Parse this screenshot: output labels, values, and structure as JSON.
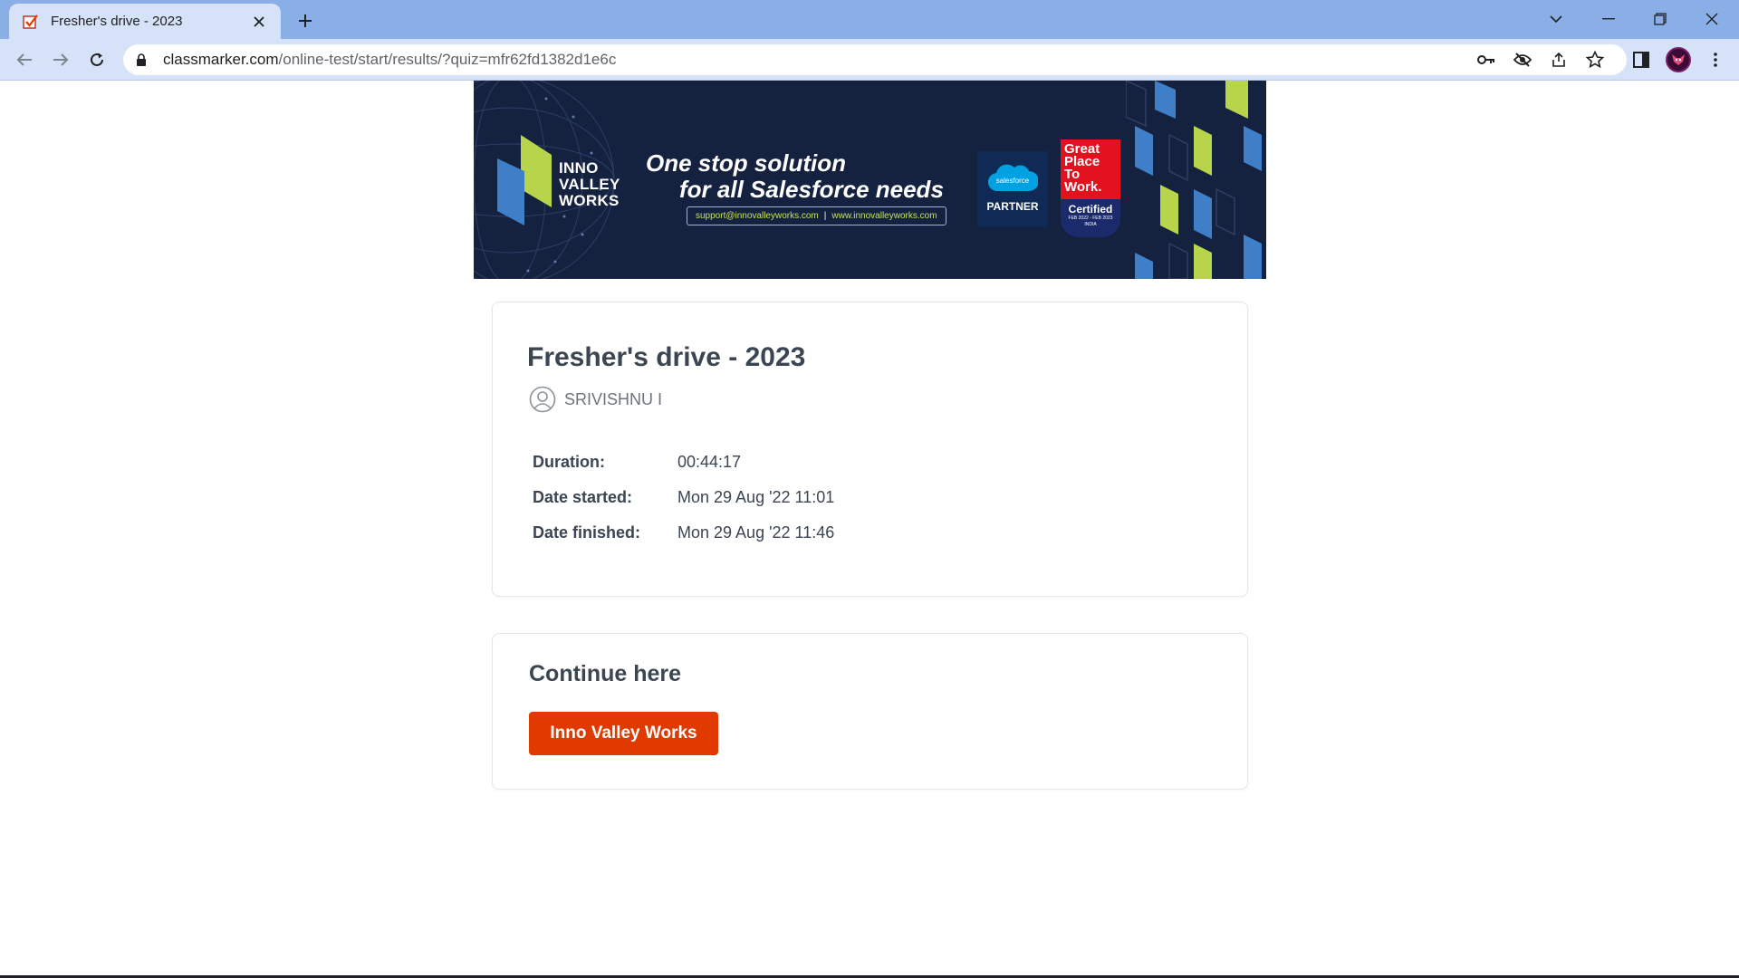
{
  "browser": {
    "tab_title": "Fresher's drive - 2023",
    "url_domain": "classmarker.com",
    "url_path": "/online-test/start/results/?quiz=mfr62fd1382d1e6c"
  },
  "banner": {
    "brand_lines": [
      "INNO",
      "VALLEY",
      "WORKS"
    ],
    "tagline_1": "One stop solution",
    "tagline_2": "for all Salesforce needs",
    "support_email": "support@innovalleyworks.com",
    "separator": "|",
    "website": "www.innovalleyworks.com",
    "salesforce_wordmark": "salesforce",
    "salesforce_partner": "PARTNER",
    "gptw_lines": [
      "Great",
      "Place",
      "To",
      "Work."
    ],
    "gptw_certified": "Certified",
    "gptw_period": "FEB 2022 - FEB 2023",
    "gptw_country": "INDIA",
    "colors": {
      "navy": "#14213f",
      "lime": "#b8d44a",
      "blue": "#3f7fc8",
      "red": "#e3101e"
    }
  },
  "result": {
    "title": "Fresher's drive - 2023",
    "user_name": "SRIVISHNU I",
    "details": [
      {
        "label": "Duration:",
        "value": "00:44:17"
      },
      {
        "label": "Date started:",
        "value": "Mon 29 Aug '22 11:01"
      },
      {
        "label": "Date finished:",
        "value": "Mon 29 Aug '22 11:46"
      }
    ]
  },
  "continue": {
    "title": "Continue here",
    "button_label": "Inno Valley Works",
    "button_color": "#e03a00"
  }
}
